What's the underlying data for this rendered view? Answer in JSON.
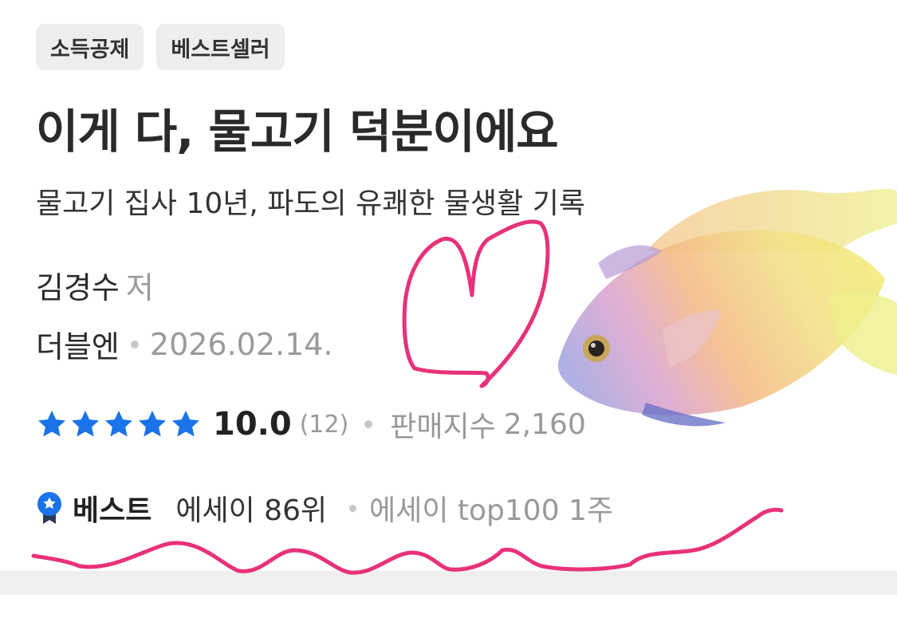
{
  "tags": [
    "소득공제",
    "베스트셀러"
  ],
  "book": {
    "title": "이게 다, 물고기 덕분이에요",
    "subtitle": "물고기 집사 10년, 파도의 유쾌한 물생활 기록",
    "author": "김경수",
    "author_role": "저",
    "publisher": "더블엔",
    "date": "2026.02.14."
  },
  "rating": {
    "stars": 5,
    "score": "10.0",
    "count": "(12)",
    "sales_label": "판매지수",
    "sales_value": "2,160",
    "star_color": "#1a73e8"
  },
  "best": {
    "label": "베스트",
    "rank": "에세이 86위",
    "weeks": "에세이 top100 1주",
    "icon": "best-badge-icon"
  },
  "annotations": {
    "ink_color": "#e8317a",
    "shapes": [
      "heart-drawing",
      "wavy-underline"
    ]
  }
}
